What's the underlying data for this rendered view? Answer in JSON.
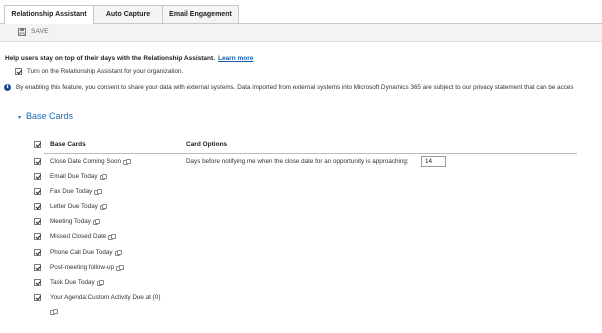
{
  "tabs": [
    {
      "label": "Relationship Assistant"
    },
    {
      "label": "Auto Capture"
    },
    {
      "label": "Email Engagement"
    }
  ],
  "toolbar": {
    "save_label": "SAVE"
  },
  "intro": {
    "heading": "Help users stay on top of their days with the Relationship Assistant.",
    "link": "Learn more",
    "enable_label": "Turn on the Relationship Assistant for your organization."
  },
  "notice": "By enabling this feature, you consent to share your data with external systems. Data imported from external systems into Microsoft Dynamics 365 are subject to our privacy statement that can be acces",
  "section": {
    "toggle": "▾",
    "title": "Base Cards"
  },
  "table": {
    "header_cards": "Base Cards",
    "header_options": "Card Options",
    "option_text": "Days before notifying me when the close date for an opportunity is approaching:",
    "days_value": "14",
    "rows": [
      {
        "label": "Close Date Coming Soon"
      },
      {
        "label": "Email Due Today"
      },
      {
        "label": "Fax Due Today"
      },
      {
        "label": "Letter Due Today"
      },
      {
        "label": "Meeting Today"
      },
      {
        "label": "Missed Closed Date"
      },
      {
        "label": "Phone Call Due Today"
      },
      {
        "label": "Post-meeting follow-up"
      },
      {
        "label": "Task Due Today"
      },
      {
        "label": "Your Agenda:Custom Activity Due at {0}"
      }
    ]
  }
}
